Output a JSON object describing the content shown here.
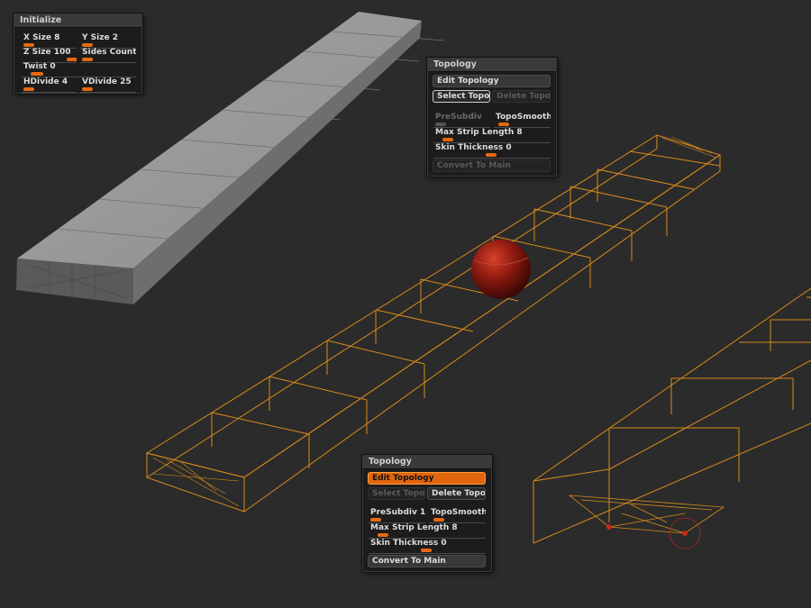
{
  "colors": {
    "background": "#2b2b2b",
    "accent": "#e86a10",
    "wireframe": "#d88a1a",
    "sphere": "#8a1a10"
  },
  "initialize_panel": {
    "title": "Initialize",
    "x_size": "X Size 8",
    "y_size": "Y Size 2",
    "z_size": "Z Size 100",
    "sides_count": "Sides Count",
    "twist": "Twist 0",
    "hdivide": "HDivide 4",
    "vdivide": "VDivide 25"
  },
  "topology_panel_top": {
    "title": "Topology",
    "edit_topology": "Edit Topology",
    "select_topo": "Select Topo",
    "delete_topo": "Delete Topo",
    "presubdiv": "PreSubdiv",
    "toposmooth": "TopoSmooth",
    "max_strip_length": "Max Strip Length 8",
    "skin_thickness": "Skin Thickness 0",
    "convert_to_main": "Convert To Main"
  },
  "topology_panel_bottom": {
    "title": "Topology",
    "edit_topology": "Edit Topology",
    "select_topo": "Select Topo",
    "delete_topo": "Delete Topo",
    "presubdiv": "PreSubdiv 1",
    "toposmooth": "TopoSmooth",
    "max_strip_length": "Max Strip Length 8",
    "skin_thickness": "Skin Thickness 0",
    "convert_to_main": "Convert To Main"
  }
}
